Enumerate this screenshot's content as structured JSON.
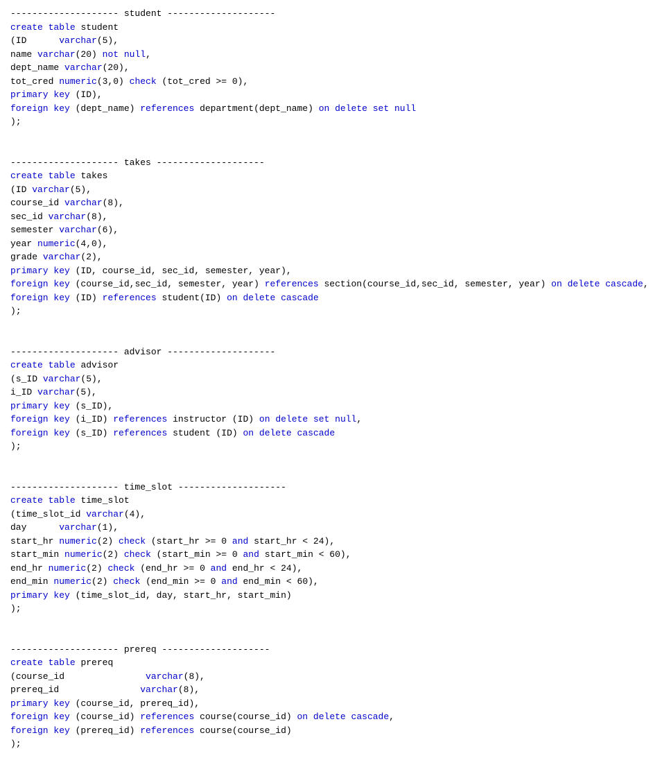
{
  "sections": [
    {
      "id": "student",
      "divider": "-------------------- student --------------------",
      "lines": [
        "create table student",
        "(ID      varchar(5),",
        "name varchar(20) not null,",
        "dept_name varchar(20),",
        "tot_cred numeric(3,0) check (tot_cred >= 0),",
        "primary key (ID),",
        "foreign key (dept_name) references department(dept_name) on delete set null",
        ");"
      ]
    },
    {
      "id": "takes",
      "divider": "-------------------- takes --------------------",
      "lines": [
        "create table takes",
        "(ID varchar(5),",
        "course_id varchar(8),",
        "sec_id varchar(8),",
        "semester varchar(6),",
        "year numeric(4,0),",
        "grade varchar(2),",
        "primary key (ID, course_id, sec_id, semester, year),",
        "foreign key (course_id,sec_id, semester, year) references section(course_id,sec_id, semester, year) on delete cascade,",
        "foreign key (ID) references student(ID) on delete cascade",
        ");"
      ]
    },
    {
      "id": "advisor",
      "divider": "-------------------- advisor --------------------",
      "lines": [
        "create table advisor",
        "(s_ID varchar(5),",
        "i_ID varchar(5),",
        "primary key (s_ID),",
        "foreign key (i_ID) references instructor (ID) on delete set null,",
        "foreign key (s_ID) references student (ID) on delete cascade",
        ");"
      ]
    },
    {
      "id": "time_slot",
      "divider": "-------------------- time_slot --------------------",
      "lines": [
        "create table time_slot",
        "(time_slot_id varchar(4),",
        "day      varchar(1),",
        "start_hr numeric(2) check (start_hr >= 0 and start_hr < 24),",
        "start_min numeric(2) check (start_min >= 0 and start_min < 60),",
        "end_hr numeric(2) check (end_hr >= 0 and end_hr < 24),",
        "end_min numeric(2) check (end_min >= 0 and end_min < 60),",
        "primary key (time_slot_id, day, start_hr, start_min)",
        ");"
      ]
    },
    {
      "id": "prereq",
      "divider": "-------------------- prereq --------------------",
      "lines": [
        "create table prereq",
        "(course_id               varchar(8),",
        "prereq_id               varchar(8),",
        "primary key (course_id, prereq_id),",
        "foreign key (course_id) references course(course_id) on delete cascade,",
        "foreign key (prereq_id) references course(course_id)",
        ");"
      ]
    }
  ]
}
